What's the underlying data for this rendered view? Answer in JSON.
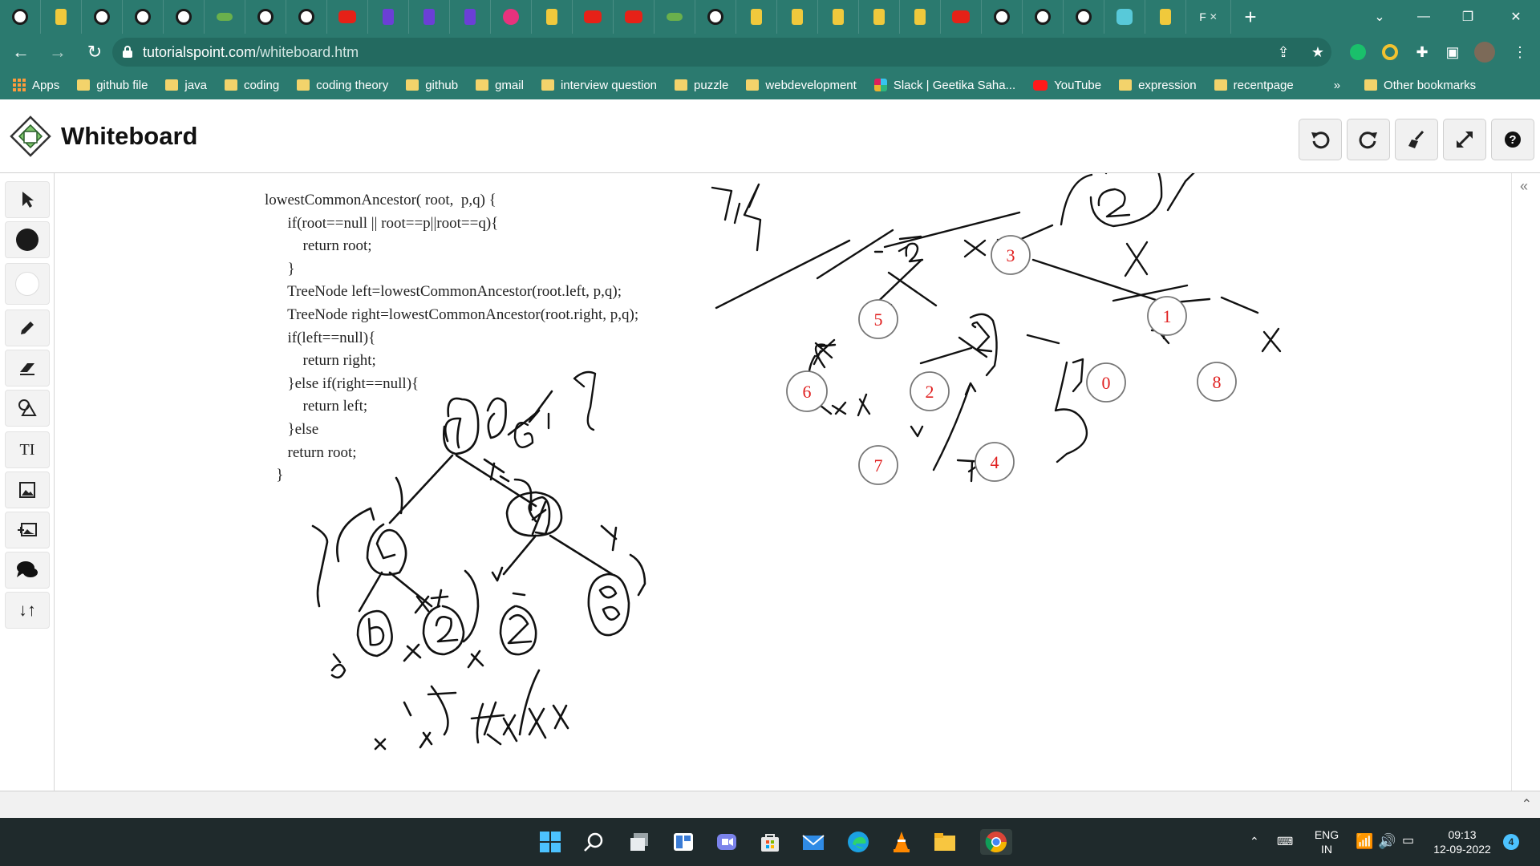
{
  "browser": {
    "active_tab": {
      "label": "F"
    },
    "url_host": "tutorialspoint.com",
    "url_path": "/whiteboard.htm"
  },
  "bookmarks": [
    {
      "label": "Apps",
      "kind": "apps"
    },
    {
      "label": "github file",
      "kind": "folder"
    },
    {
      "label": "java",
      "kind": "folder"
    },
    {
      "label": "coding",
      "kind": "folder"
    },
    {
      "label": "coding theory",
      "kind": "folder"
    },
    {
      "label": "github",
      "kind": "folder"
    },
    {
      "label": "gmail",
      "kind": "folder"
    },
    {
      "label": "interview question",
      "kind": "folder"
    },
    {
      "label": "puzzle",
      "kind": "folder"
    },
    {
      "label": "webdevelopment",
      "kind": "folder"
    },
    {
      "label": "Slack | Geetika Saha...",
      "kind": "slack"
    },
    {
      "label": "YouTube",
      "kind": "youtube"
    },
    {
      "label": "expression",
      "kind": "folder"
    },
    {
      "label": "recentpage",
      "kind": "folder"
    }
  ],
  "bookmarks_more": "»",
  "other_bookmarks": "Other bookmarks",
  "app": {
    "title": "Whiteboard"
  },
  "code_lines": [
    "lowestCommonAncestor( root,  p,q) {",
    "      if(root==null || root==p||root==q){",
    "          return root;",
    "      }",
    "      TreeNode left=lowestCommonAncestor(root.left, p,q);",
    "      TreeNode right=lowestCommonAncestor(root.right, p,q);",
    "      if(left==null){",
    "          return right;",
    "      }else if(right==null){",
    "          return left;",
    "      }else",
    "      return root;",
    "   }"
  ],
  "tree_nodes": [
    {
      "label": "3"
    },
    {
      "label": "5"
    },
    {
      "label": "1"
    },
    {
      "label": "6"
    },
    {
      "label": "2"
    },
    {
      "label": "0"
    },
    {
      "label": "8"
    },
    {
      "label": "7"
    },
    {
      "label": "4"
    }
  ],
  "taskbar": {
    "lang_top": "ENG",
    "lang_bottom": "IN",
    "time": "09:13",
    "date": "12-09-2022",
    "notifications": "4"
  },
  "colors": {
    "browser_chrome": "#2b7a6f",
    "node_text": "#e02020",
    "taskbar": "#1f2a2c"
  }
}
